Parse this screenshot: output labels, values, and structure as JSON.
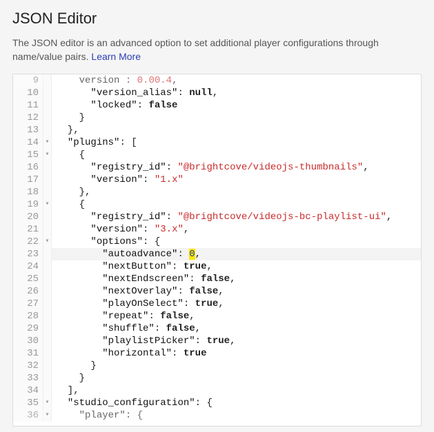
{
  "header": {
    "title": "JSON Editor",
    "description_prefix": "The JSON editor is an advanced option to set additional player configurations through name/value pairs. ",
    "learn_more": "Learn More"
  },
  "editor": {
    "fold_marker": "▾",
    "lines": [
      {
        "num": "9",
        "fold": "",
        "hl": false,
        "partial": true,
        "tokens": [
          [
            "    ",
            "p"
          ],
          [
            "version",
            "k"
          ],
          [
            " : ",
            "p"
          ],
          [
            "0.00.4",
            "s"
          ],
          [
            ",",
            "p"
          ]
        ]
      },
      {
        "num": "10",
        "fold": "",
        "hl": false,
        "tokens": [
          [
            "      ",
            "p"
          ],
          [
            "\"version_alias\"",
            "k"
          ],
          [
            ": ",
            "p"
          ],
          [
            "null",
            "c"
          ],
          [
            ",",
            "p"
          ]
        ]
      },
      {
        "num": "11",
        "fold": "",
        "hl": false,
        "tokens": [
          [
            "      ",
            "p"
          ],
          [
            "\"locked\"",
            "k"
          ],
          [
            ": ",
            "p"
          ],
          [
            "false",
            "c"
          ]
        ]
      },
      {
        "num": "12",
        "fold": "",
        "hl": false,
        "tokens": [
          [
            "    }",
            "p"
          ]
        ]
      },
      {
        "num": "13",
        "fold": "",
        "hl": false,
        "tokens": [
          [
            "  },",
            "p"
          ]
        ]
      },
      {
        "num": "14",
        "fold": "▾",
        "hl": false,
        "tokens": [
          [
            "  ",
            "p"
          ],
          [
            "\"plugins\"",
            "k"
          ],
          [
            ": [",
            "p"
          ]
        ]
      },
      {
        "num": "15",
        "fold": "▾",
        "hl": false,
        "tokens": [
          [
            "    {",
            "p"
          ]
        ]
      },
      {
        "num": "16",
        "fold": "",
        "hl": false,
        "tokens": [
          [
            "      ",
            "p"
          ],
          [
            "\"registry_id\"",
            "k"
          ],
          [
            ": ",
            "p"
          ],
          [
            "\"@brightcove/videojs-thumbnails\"",
            "s"
          ],
          [
            ",",
            "p"
          ]
        ]
      },
      {
        "num": "17",
        "fold": "",
        "hl": false,
        "tokens": [
          [
            "      ",
            "p"
          ],
          [
            "\"version\"",
            "k"
          ],
          [
            ": ",
            "p"
          ],
          [
            "\"1.x\"",
            "s"
          ]
        ]
      },
      {
        "num": "18",
        "fold": "",
        "hl": false,
        "tokens": [
          [
            "    },",
            "p"
          ]
        ]
      },
      {
        "num": "19",
        "fold": "▾",
        "hl": false,
        "tokens": [
          [
            "    {",
            "p"
          ]
        ]
      },
      {
        "num": "20",
        "fold": "",
        "hl": false,
        "tokens": [
          [
            "      ",
            "p"
          ],
          [
            "\"registry_id\"",
            "k"
          ],
          [
            ": ",
            "p"
          ],
          [
            "\"@brightcove/videojs-bc-playlist-ui\"",
            "s"
          ],
          [
            ",",
            "p"
          ]
        ]
      },
      {
        "num": "21",
        "fold": "",
        "hl": false,
        "tokens": [
          [
            "      ",
            "p"
          ],
          [
            "\"version\"",
            "k"
          ],
          [
            ": ",
            "p"
          ],
          [
            "\"3.x\"",
            "s"
          ],
          [
            ",",
            "p"
          ]
        ]
      },
      {
        "num": "22",
        "fold": "▾",
        "hl": false,
        "tokens": [
          [
            "      ",
            "p"
          ],
          [
            "\"options\"",
            "k"
          ],
          [
            ": {",
            "p"
          ]
        ]
      },
      {
        "num": "23",
        "fold": "",
        "hl": true,
        "tokens": [
          [
            "        ",
            "p"
          ],
          [
            "\"autoadvance\"",
            "k"
          ],
          [
            ": ",
            "p"
          ],
          [
            "0",
            "nH"
          ],
          [
            ",",
            "p"
          ]
        ]
      },
      {
        "num": "24",
        "fold": "",
        "hl": false,
        "tokens": [
          [
            "        ",
            "p"
          ],
          [
            "\"nextButton\"",
            "k"
          ],
          [
            ": ",
            "p"
          ],
          [
            "true",
            "c"
          ],
          [
            ",",
            "p"
          ]
        ]
      },
      {
        "num": "25",
        "fold": "",
        "hl": false,
        "tokens": [
          [
            "        ",
            "p"
          ],
          [
            "\"nextEndscreen\"",
            "k"
          ],
          [
            ": ",
            "p"
          ],
          [
            "false",
            "c"
          ],
          [
            ",",
            "p"
          ]
        ]
      },
      {
        "num": "26",
        "fold": "",
        "hl": false,
        "tokens": [
          [
            "        ",
            "p"
          ],
          [
            "\"nextOverlay\"",
            "k"
          ],
          [
            ": ",
            "p"
          ],
          [
            "false",
            "c"
          ],
          [
            ",",
            "p"
          ]
        ]
      },
      {
        "num": "27",
        "fold": "",
        "hl": false,
        "tokens": [
          [
            "        ",
            "p"
          ],
          [
            "\"playOnSelect\"",
            "k"
          ],
          [
            ": ",
            "p"
          ],
          [
            "true",
            "c"
          ],
          [
            ",",
            "p"
          ]
        ]
      },
      {
        "num": "28",
        "fold": "",
        "hl": false,
        "tokens": [
          [
            "        ",
            "p"
          ],
          [
            "\"repeat\"",
            "k"
          ],
          [
            ": ",
            "p"
          ],
          [
            "false",
            "c"
          ],
          [
            ",",
            "p"
          ]
        ]
      },
      {
        "num": "29",
        "fold": "",
        "hl": false,
        "tokens": [
          [
            "        ",
            "p"
          ],
          [
            "\"shuffle\"",
            "k"
          ],
          [
            ": ",
            "p"
          ],
          [
            "false",
            "c"
          ],
          [
            ",",
            "p"
          ]
        ]
      },
      {
        "num": "30",
        "fold": "",
        "hl": false,
        "tokens": [
          [
            "        ",
            "p"
          ],
          [
            "\"playlistPicker\"",
            "k"
          ],
          [
            ": ",
            "p"
          ],
          [
            "true",
            "c"
          ],
          [
            ",",
            "p"
          ]
        ]
      },
      {
        "num": "31",
        "fold": "",
        "hl": false,
        "tokens": [
          [
            "        ",
            "p"
          ],
          [
            "\"horizontal\"",
            "k"
          ],
          [
            ": ",
            "p"
          ],
          [
            "true",
            "c"
          ]
        ]
      },
      {
        "num": "32",
        "fold": "",
        "hl": false,
        "tokens": [
          [
            "      }",
            "p"
          ]
        ]
      },
      {
        "num": "33",
        "fold": "",
        "hl": false,
        "tokens": [
          [
            "    }",
            "p"
          ]
        ]
      },
      {
        "num": "34",
        "fold": "",
        "hl": false,
        "tokens": [
          [
            "  ],",
            "p"
          ]
        ]
      },
      {
        "num": "35",
        "fold": "▾",
        "hl": false,
        "tokens": [
          [
            "  ",
            "p"
          ],
          [
            "\"studio_configuration\"",
            "k"
          ],
          [
            ": {",
            "p"
          ]
        ]
      },
      {
        "num": "36",
        "fold": "▾",
        "hl": false,
        "partial": true,
        "tokens": [
          [
            "    ",
            "p"
          ],
          [
            "\"player\":",
            "k"
          ],
          [
            " {",
            "p"
          ]
        ]
      }
    ]
  }
}
